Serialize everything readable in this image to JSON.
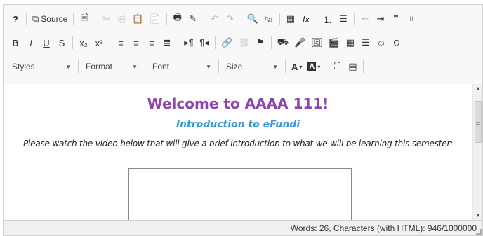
{
  "toolbar": {
    "row1": [
      {
        "type": "btn",
        "name": "help-icon",
        "glyph": "?",
        "bold": true
      },
      {
        "type": "sep"
      },
      {
        "type": "btn",
        "name": "source-button",
        "glyph": "⧉",
        "label_key": "source_label"
      },
      {
        "type": "sep"
      },
      {
        "type": "btn",
        "name": "templates-icon",
        "glyph": "🗎"
      },
      {
        "type": "sep"
      },
      {
        "type": "btn",
        "name": "cut-icon",
        "glyph": "✂",
        "disabled": true
      },
      {
        "type": "btn",
        "name": "copy-icon",
        "glyph": "⎘",
        "disabled": true
      },
      {
        "type": "btn",
        "name": "paste-icon",
        "glyph": "📋"
      },
      {
        "type": "btn",
        "name": "paste-text-icon",
        "glyph": "📄"
      },
      {
        "type": "sep"
      },
      {
        "type": "btn",
        "name": "print-icon",
        "glyph": "🖶"
      },
      {
        "type": "btn",
        "name": "spellcheck-icon",
        "glyph": "✎"
      },
      {
        "type": "sep"
      },
      {
        "type": "btn",
        "name": "undo-icon",
        "glyph": "↶",
        "disabled": true
      },
      {
        "type": "btn",
        "name": "redo-icon",
        "glyph": "↷",
        "disabled": true
      },
      {
        "type": "sep"
      },
      {
        "type": "btn",
        "name": "find-icon",
        "glyph": "🔍"
      },
      {
        "type": "btn",
        "name": "replace-icon",
        "glyph": "ᵇa"
      },
      {
        "type": "sep"
      },
      {
        "type": "btn",
        "name": "select-all-icon",
        "glyph": "▦"
      },
      {
        "type": "btn",
        "name": "remove-format-icon",
        "glyph": "Ix",
        "italic": true
      },
      {
        "type": "sep"
      },
      {
        "type": "btn",
        "name": "numbered-list-icon",
        "glyph": "⒈"
      },
      {
        "type": "btn",
        "name": "bulleted-list-icon",
        "glyph": "☰"
      },
      {
        "type": "sep"
      },
      {
        "type": "btn",
        "name": "outdent-icon",
        "glyph": "⇤",
        "disabled": true
      },
      {
        "type": "btn",
        "name": "indent-icon",
        "glyph": "⇥"
      },
      {
        "type": "btn",
        "name": "blockquote-icon",
        "glyph": "❞",
        "bold": true
      },
      {
        "type": "btn",
        "name": "div-container-icon",
        "glyph": "⌗"
      }
    ],
    "row2": [
      {
        "type": "btn",
        "name": "bold-icon",
        "glyph": "B",
        "bold": true
      },
      {
        "type": "btn",
        "name": "italic-icon",
        "glyph": "I",
        "italic": true
      },
      {
        "type": "btn",
        "name": "underline-icon",
        "glyph": "U",
        "underline": true
      },
      {
        "type": "btn",
        "name": "strike-icon",
        "glyph": "S",
        "strike": true
      },
      {
        "type": "sep"
      },
      {
        "type": "btn",
        "name": "subscript-icon",
        "glyph": "x₂"
      },
      {
        "type": "btn",
        "name": "superscript-icon",
        "glyph": "x²"
      },
      {
        "type": "sep"
      },
      {
        "type": "btn",
        "name": "align-left-icon",
        "glyph": "≡"
      },
      {
        "type": "btn",
        "name": "align-center-icon",
        "glyph": "≡"
      },
      {
        "type": "btn",
        "name": "align-right-icon",
        "glyph": "≡"
      },
      {
        "type": "btn",
        "name": "align-justify-icon",
        "glyph": "≣"
      },
      {
        "type": "sep"
      },
      {
        "type": "btn",
        "name": "ltr-icon",
        "glyph": "▸¶"
      },
      {
        "type": "btn",
        "name": "rtl-icon",
        "glyph": "¶◂"
      },
      {
        "type": "sep"
      },
      {
        "type": "btn",
        "name": "link-icon",
        "glyph": "🔗"
      },
      {
        "type": "btn",
        "name": "unlink-icon",
        "glyph": "⛓",
        "disabled": true
      },
      {
        "type": "btn",
        "name": "anchor-icon",
        "glyph": "⚑"
      },
      {
        "type": "sep"
      },
      {
        "type": "btn",
        "name": "content-item-icon",
        "glyph": "⛟"
      },
      {
        "type": "btn",
        "name": "audio-icon",
        "glyph": "🎤"
      },
      {
        "type": "btn",
        "name": "image-icon",
        "glyph": "🖼"
      },
      {
        "type": "btn",
        "name": "media-icon",
        "glyph": "🎬"
      },
      {
        "type": "btn",
        "name": "table-icon",
        "glyph": "▦"
      },
      {
        "type": "btn",
        "name": "horizontal-rule-icon",
        "glyph": "☰"
      },
      {
        "type": "btn",
        "name": "smiley-icon",
        "glyph": "☺"
      },
      {
        "type": "btn",
        "name": "special-char-icon",
        "glyph": "Ω"
      }
    ],
    "source_label": "Source",
    "styles_label": "Styles",
    "format_label": "Format",
    "font_label": "Font",
    "size_label": "Size"
  },
  "content": {
    "heading": "Welcome to AAAA 111!",
    "subheading": "Introduction to eFundi",
    "paragraph": "Please watch the video below that will give a brief introduction to what we will be learning this semester:",
    "heading_color": "#8e44ad",
    "subheading_color": "#3498db"
  },
  "status": {
    "word_count": "Words: 26, Characters (with HTML): 946/1000000"
  }
}
